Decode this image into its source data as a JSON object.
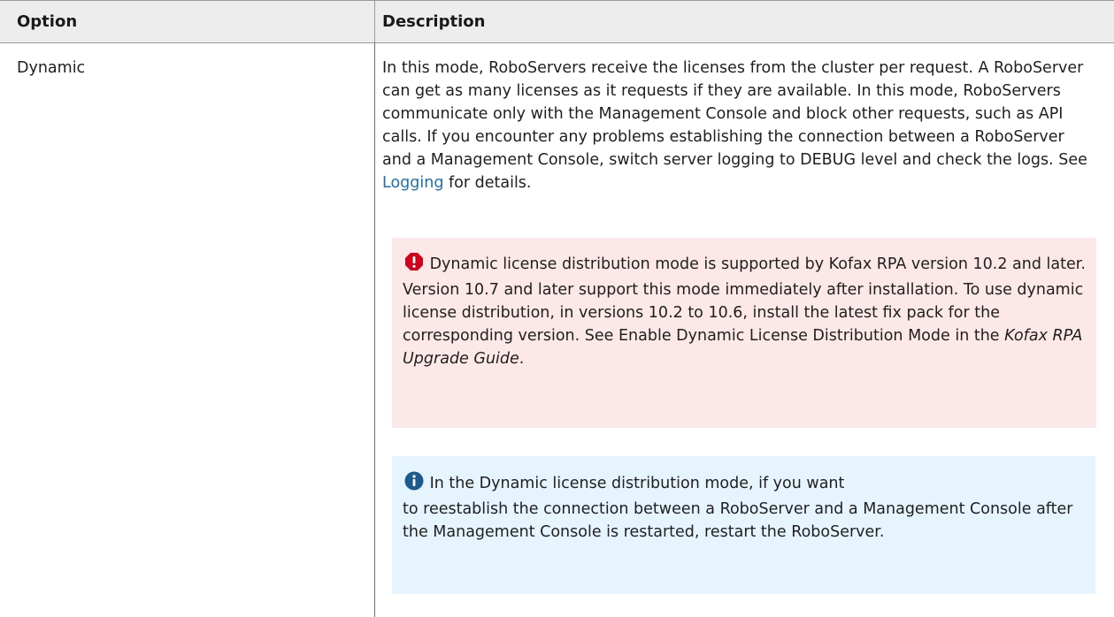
{
  "table": {
    "headers": {
      "option": "Option",
      "description": "Description"
    },
    "rows": [
      {
        "option": "Dynamic",
        "description": {
          "para_part1": "In this mode, RoboServers receive the licenses from the cluster per request. A RoboServer can get as many licenses as it requests if they are available. In this mode, RoboServers communicate only with the Management Console and block other requests, such as API calls. If you encounter any problems establishing the connection between a RoboServer and a Management Console, switch server logging to DEBUG level and check the logs. See ",
          "link_text": "Logging",
          "para_part2": " for details."
        },
        "warning_note": {
          "icon": "exclamation-octagon-icon",
          "color": "#d0021b",
          "background": "#fde8e8",
          "text_part1": " Dynamic license distribution mode is supported by Kofax RPA version 10.2 and later. Version 10.7 and later support this mode immediately after installation. To use dynamic license distribution, in versions 10.2 to 10.6, install the latest fix pack for the corresponding version. See Enable Dynamic License Distribution Mode in the ",
          "emphasis": "Kofax RPA Upgrade Guide",
          "text_part2": "."
        },
        "info_note": {
          "icon": "info-circle-icon",
          "color": "#1c5b8d",
          "background": "#e6f4fd",
          "line1": " In the Dynamic license distribution mode, if you want",
          "rest": "to reestablish the connection between a RoboServer and a Management Console after the Management Console is restarted, restart the RoboServer."
        }
      }
    ]
  },
  "colors": {
    "header_background": "#ededed",
    "link": "#1f6fb2",
    "border": "#9a9a9a"
  }
}
